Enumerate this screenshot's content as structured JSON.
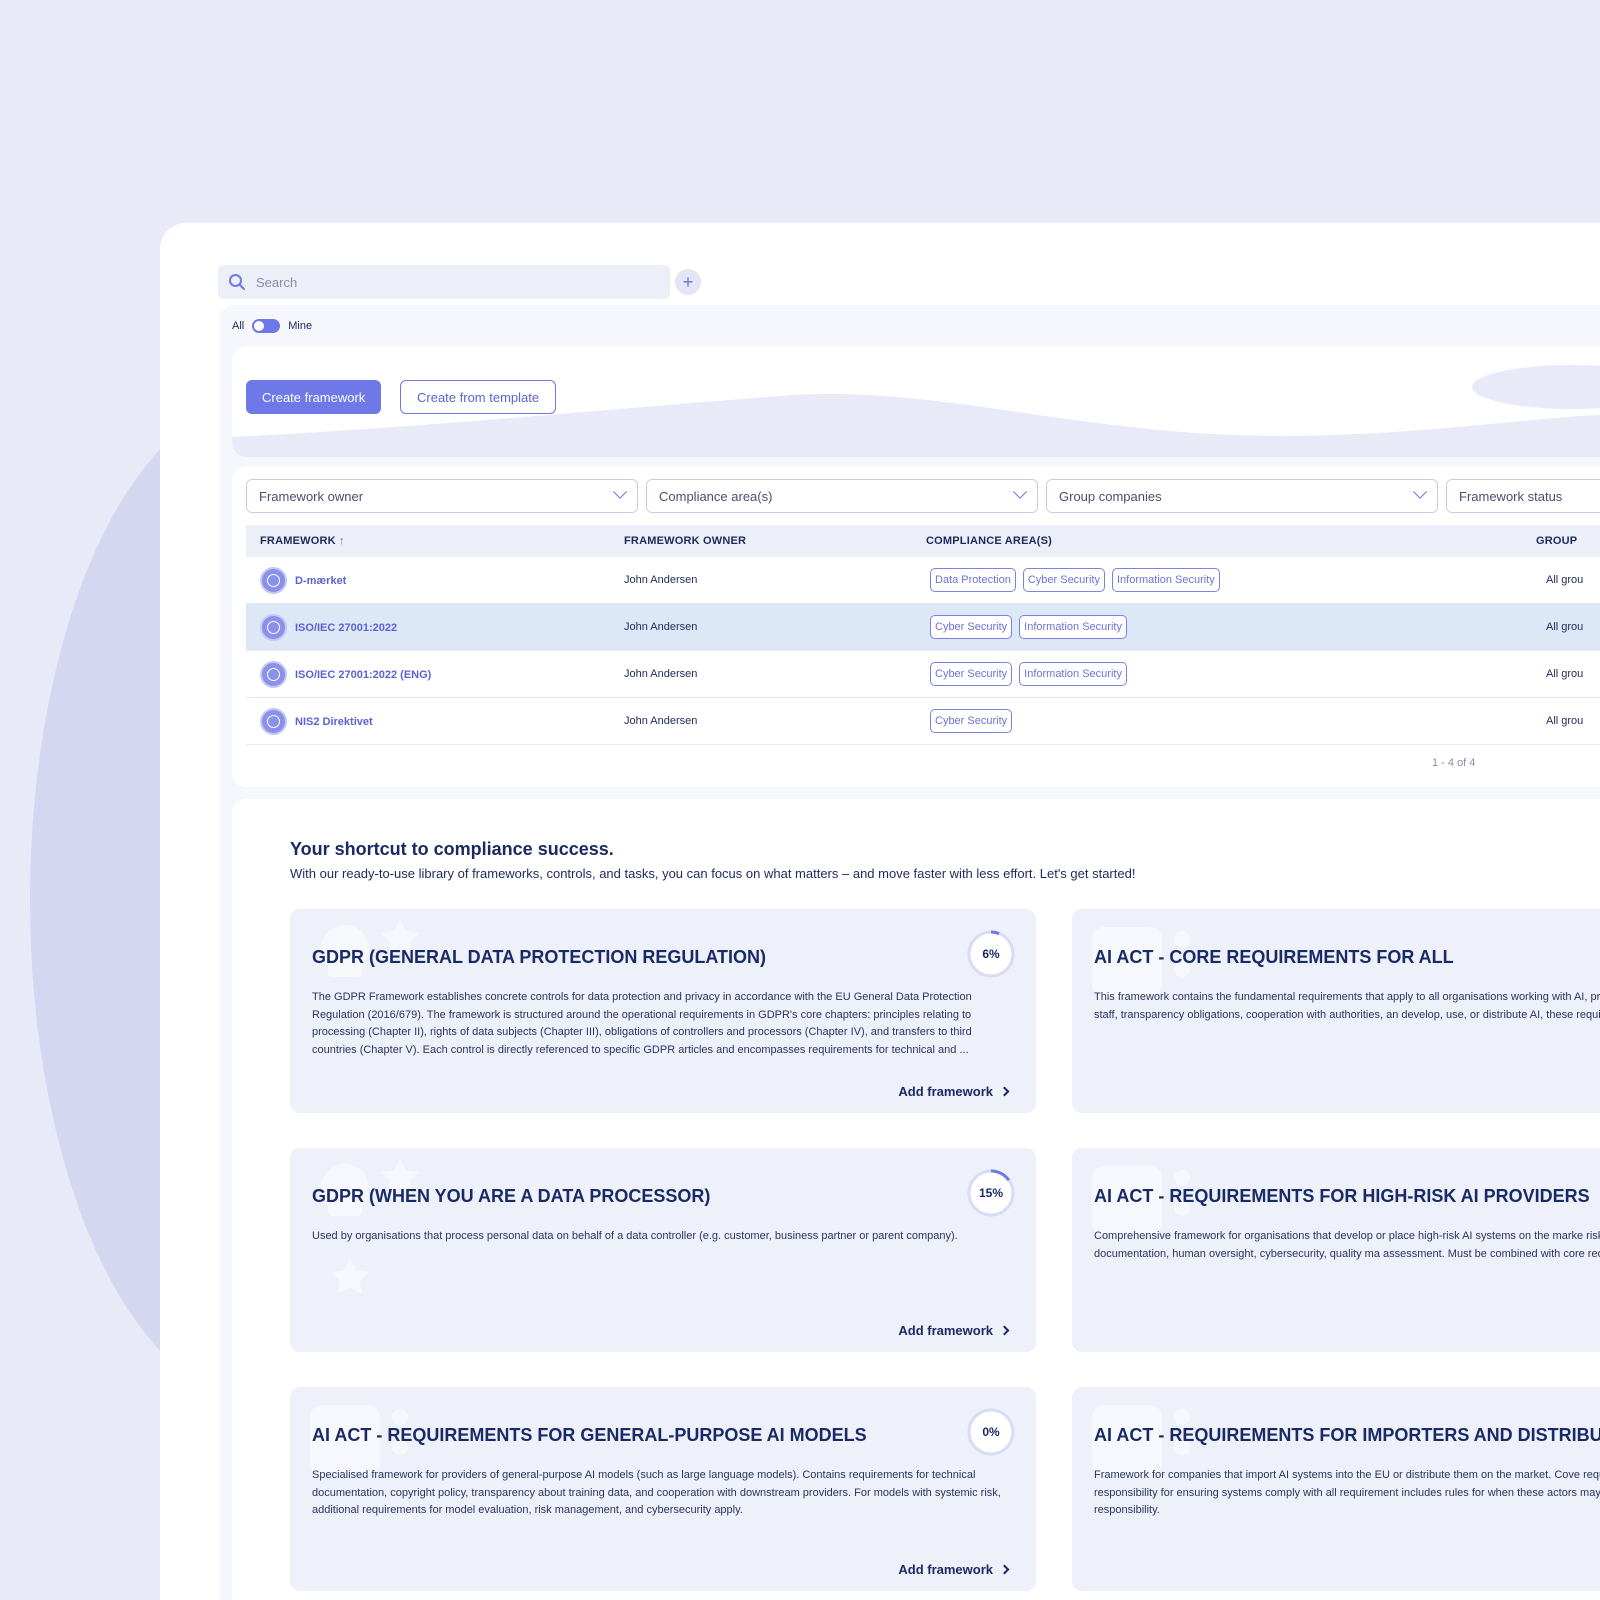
{
  "search": {
    "placeholder": "Search",
    "add_label": "+"
  },
  "toggle": {
    "left": "All",
    "right": "Mine"
  },
  "actions": {
    "create": "Create framework",
    "template": "Create from template"
  },
  "filters": [
    "Framework owner",
    "Compliance area(s)",
    "Group companies",
    "Framework status"
  ],
  "table": {
    "columns": [
      "FRAMEWORK",
      "FRAMEWORK OWNER",
      "COMPLIANCE AREA(S)",
      "GROUP"
    ],
    "sort_indicator": "↑",
    "rows": [
      {
        "name": "D-mærket",
        "owner": "John Andersen",
        "areas": [
          "Data Protection",
          "Cyber Security",
          "Information Security"
        ],
        "group": "All grou"
      },
      {
        "name": "ISO/IEC 27001:2022",
        "owner": "John Andersen",
        "areas": [
          "Cyber Security",
          "Information Security"
        ],
        "group": "All grou"
      },
      {
        "name": "ISO/IEC 27001:2022 (ENG)",
        "owner": "John Andersen",
        "areas": [
          "Cyber Security",
          "Information Security"
        ],
        "group": "All grou"
      },
      {
        "name": "NIS2 Direktivet",
        "owner": "John Andersen",
        "areas": [
          "Cyber Security"
        ],
        "group": "All grou"
      }
    ],
    "pager": "1 - 4 of 4"
  },
  "library": {
    "title": "Your shortcut to compliance success.",
    "subtitle": "With our ready-to-use library of frameworks, controls, and tasks, you can focus on what matters – and move faster with less effort. Let's get started!",
    "cta": "Add framework",
    "cards": [
      {
        "title": "GDPR (GENERAL DATA PROTECTION REGULATION)",
        "progress": 6,
        "progress_label": "6%",
        "description": "The GDPR Framework establishes concrete controls for data protection and privacy in accordance with the EU General Data Protection Regulation (2016/679). The framework is structured around the operational requirements in GDPR's core chapters: principles relating to processing (Chapter II), rights of data subjects (Chapter III), obligations of controllers and processors (Chapter IV), and transfers to third countries (Chapter V). Each control is directly referenced to specific GDPR articles and encompasses requirements for technical and ..."
      },
      {
        "title": "AI ACT - CORE REQUIREMENTS FOR ALL",
        "description": "This framework contains the fundamental requirements that apply to all organisations working with AI, prohibited AI practices, AI literacy for staff, transparency obligations, cooperation with authorities, an develop, use, or distribute AI, these requirements must be met."
      },
      {
        "title": "GDPR (WHEN YOU ARE A DATA PROCESSOR)",
        "progress": 15,
        "progress_label": "15%",
        "description": "Used by organisations that process personal data on behalf of a data controller (e.g. customer, business partner or parent company)."
      },
      {
        "title": "AI ACT - REQUIREMENTS FOR HIGH-RISK AI PROVIDERS",
        "description": "Comprehensive framework for organisations that develop or place high-risk AI systems on the marke risk management, data quality, technical documentation, human oversight, cybersecurity, quality ma assessment. Must be combined with core requirements."
      },
      {
        "title": "AI ACT - REQUIREMENTS FOR GENERAL-PURPOSE AI MODELS",
        "progress": 0,
        "progress_label": "0%",
        "description": "Specialised framework for providers of general-purpose AI models (such as large language models). Contains requirements for technical documentation, copyright policy, transparency about training data, and cooperation with downstream providers. For models with systemic risk, additional requirements for model evaluation, risk management, and cybersecurity apply."
      },
      {
        "title": "AI ACT - REQUIREMENTS FOR IMPORTERS AND DISTRIBUTO",
        "description": "Framework for companies that import AI systems into the EU or distribute them on the market. Cove requirements, product labelling, and responsibility for ensuring systems comply with all requirement includes rules for when these actors may be considered providers with full responsibility."
      }
    ]
  },
  "colors": {
    "accent": "#6e78e6",
    "navy": "#1a2a64",
    "page_bg": "#e8eaf7",
    "selected_row": "#dde8f7"
  }
}
